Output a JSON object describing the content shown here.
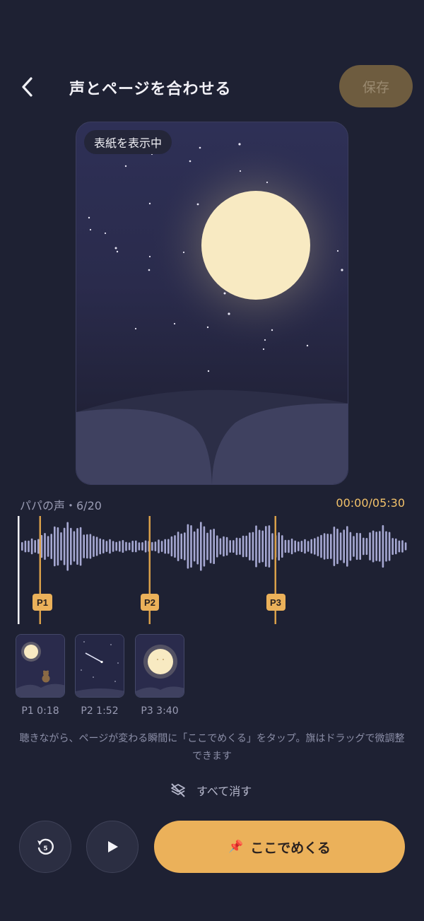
{
  "header": {
    "title": "声とページを合わせる",
    "save_label": "保存"
  },
  "cover": {
    "badge": "表紙を表示中"
  },
  "track": {
    "name": "パパの声・6/20",
    "time": "00:00/05:30",
    "progress": 0,
    "markers": [
      "P1",
      "P2",
      "P3"
    ]
  },
  "thumbnails": [
    {
      "label": "P1 0:18"
    },
    {
      "label": "P2 1:52"
    },
    {
      "label": "P3 3:40"
    }
  ],
  "hint": "聴きながら、ページが変わる瞬間に「ここでめくる」をタップ。旗はドラッグで微調整できます",
  "clear_all": {
    "label": "すべて消す"
  },
  "controls": {
    "rewind_label": "5",
    "flip_label": "ここでめくる",
    "flip_icon": "📌"
  },
  "colors": {
    "accent": "#ebb15a",
    "background": "#1e2133",
    "marker": "#d9a04a",
    "moon": "#f8eac2",
    "wave": "#a6a8d2"
  },
  "icons": [
    "back-arrow-icon",
    "layers-clear-icon",
    "rewind-5-icon",
    "play-icon",
    "pin-icon"
  ]
}
